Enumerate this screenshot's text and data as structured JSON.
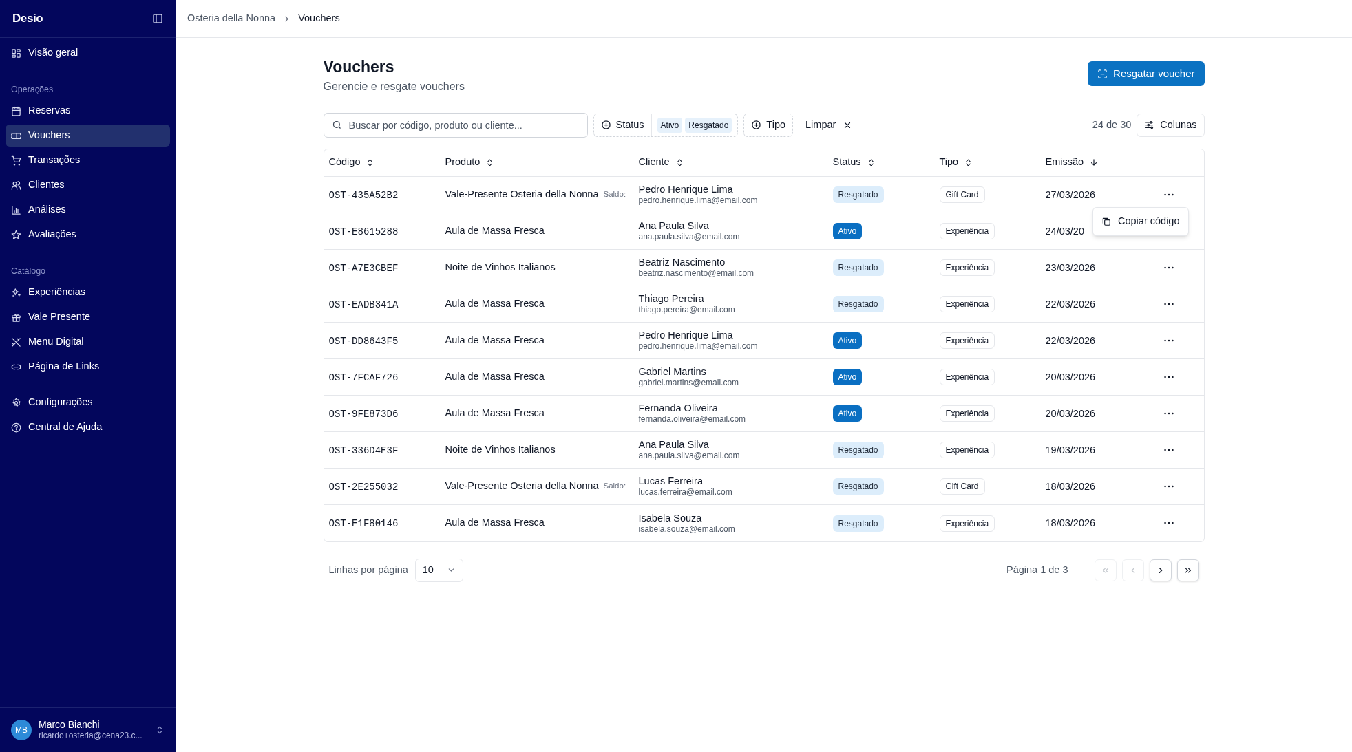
{
  "brand": "Desio",
  "sidebar": {
    "sections": [
      {
        "items": [
          {
            "label": "Visão geral",
            "selected": false
          }
        ]
      },
      {
        "label": "Operações",
        "items": [
          {
            "label": "Reservas",
            "selected": false
          },
          {
            "label": "Vouchers",
            "selected": true
          },
          {
            "label": "Transações",
            "selected": false
          },
          {
            "label": "Clientes",
            "selected": false
          },
          {
            "label": "Análises",
            "selected": false
          },
          {
            "label": "Avaliações",
            "selected": false
          }
        ]
      },
      {
        "label": "Catálogo",
        "items": [
          {
            "label": "Experiências",
            "selected": false
          },
          {
            "label": "Vale Presente",
            "selected": false
          },
          {
            "label": "Menu Digital",
            "selected": false
          },
          {
            "label": "Página de Links",
            "selected": false
          }
        ]
      },
      {
        "items": [
          {
            "label": "Configurações",
            "selected": false
          },
          {
            "label": "Central de Ajuda",
            "selected": false
          }
        ]
      }
    ],
    "user": {
      "initials": "MB",
      "name": "Marco Bianchi",
      "email": "ricardo+osteria@cena23.c..."
    }
  },
  "breadcrumb": [
    "Osteria della Nonna",
    "Vouchers"
  ],
  "page": {
    "title": "Vouchers",
    "subtitle": "Gerencie e resgate vouchers",
    "action": "Resgatar voucher"
  },
  "toolbar": {
    "search_placeholder": "Buscar por código, produto ou cliente...",
    "filters": [
      {
        "label": "Status",
        "values": [
          "Ativo",
          "Resgatado"
        ]
      },
      {
        "label": "Tipo"
      }
    ],
    "clear": "Limpar",
    "count": "24 de 30",
    "columns_button": "Colunas"
  },
  "table": {
    "columns": [
      {
        "label": "Código",
        "sorted": false
      },
      {
        "label": "Produto",
        "sorted": false
      },
      {
        "label": "Cliente",
        "sorted": false
      },
      {
        "label": "Status",
        "sorted": false
      },
      {
        "label": "Tipo",
        "sorted": false
      },
      {
        "label": "Emissão",
        "sorted": true
      }
    ],
    "rows": [
      {
        "code": "OST-435A52B2",
        "product": "Vale-Presente Osteria della Nonna",
        "note": "Saldo:",
        "client": "Pedro Henrique Lima",
        "email": "pedro.henrique.lima@email.com",
        "status": "Resgatado",
        "active": false,
        "type": "Gift Card",
        "date": "27/03/2026",
        "more_button": true,
        "menu": [
          "Copiar código"
        ]
      },
      {
        "code": "OST-E8615288",
        "product": "Aula de Massa Fresca",
        "client": "Ana Paula Silva",
        "email": "ana.paula.silva@email.com",
        "status": "Ativo",
        "active": true,
        "type": "Experiência",
        "date": "24/03/20",
        "more_button": false
      },
      {
        "code": "OST-A7E3CBEF",
        "product": "Noite de Vinhos Italianos",
        "client": "Beatriz Nascimento",
        "email": "beatriz.nascimento@email.com",
        "status": "Resgatado",
        "active": false,
        "type": "Experiência",
        "date": "23/03/2026",
        "more_button": true
      },
      {
        "code": "OST-EADB341A",
        "product": "Aula de Massa Fresca",
        "client": "Thiago Pereira",
        "email": "thiago.pereira@email.com",
        "status": "Resgatado",
        "active": false,
        "type": "Experiência",
        "date": "22/03/2026",
        "more_button": true
      },
      {
        "code": "OST-DD8643F5",
        "product": "Aula de Massa Fresca",
        "client": "Pedro Henrique Lima",
        "email": "pedro.henrique.lima@email.com",
        "status": "Ativo",
        "active": true,
        "type": "Experiência",
        "date": "22/03/2026",
        "more_button": true
      },
      {
        "code": "OST-7FCAF726",
        "product": "Aula de Massa Fresca",
        "client": "Gabriel Martins",
        "email": "gabriel.martins@email.com",
        "status": "Ativo",
        "active": true,
        "type": "Experiência",
        "date": "20/03/2026",
        "more_button": true
      },
      {
        "code": "OST-9FE873D6",
        "product": "Aula de Massa Fresca",
        "client": "Fernanda Oliveira",
        "email": "fernanda.oliveira@email.com",
        "status": "Ativo",
        "active": true,
        "type": "Experiência",
        "date": "20/03/2026",
        "more_button": true
      },
      {
        "code": "OST-336D4E3F",
        "product": "Noite de Vinhos Italianos",
        "client": "Ana Paula Silva",
        "email": "ana.paula.silva@email.com",
        "status": "Resgatado",
        "active": false,
        "type": "Experiência",
        "date": "19/03/2026",
        "more_button": true
      },
      {
        "code": "OST-2E255032",
        "product": "Vale-Presente Osteria della Nonna",
        "note": "Saldo:",
        "client": "Lucas Ferreira",
        "email": "lucas.ferreira@email.com",
        "status": "Resgatado",
        "active": false,
        "type": "Gift Card",
        "date": "18/03/2026",
        "more_button": true
      },
      {
        "code": "OST-E1F80146",
        "product": "Aula de Massa Fresca",
        "client": "Isabela Souza",
        "email": "isabela.souza@email.com",
        "status": "Resgatado",
        "active": false,
        "type": "Experiência",
        "date": "18/03/2026",
        "more_button": true
      }
    ]
  },
  "pagination": {
    "rows_label": "Linhas por página",
    "rows_value": "10",
    "page_label": "Página 1 de 3",
    "buttons": [
      {
        "kind": "first",
        "disabled": true
      },
      {
        "kind": "prev",
        "disabled": true
      },
      {
        "kind": "next",
        "disabled": false
      },
      {
        "kind": "last",
        "disabled": false
      }
    ]
  }
}
